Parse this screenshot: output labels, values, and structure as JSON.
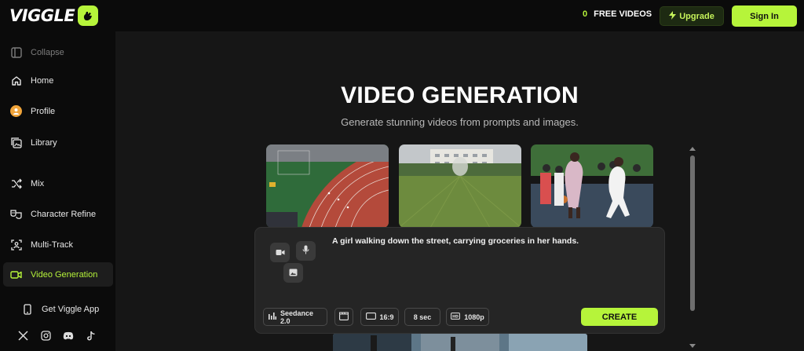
{
  "brand": {
    "name": "VIGGLE",
    "accent": "#b6f43a"
  },
  "header": {
    "credits_count": "0",
    "credits_label": "FREE VIDEOS",
    "upgrade_label": "Upgrade",
    "signin_label": "Sign In"
  },
  "sidebar": {
    "collapse_label": "Collapse",
    "items": [
      {
        "label": "Home",
        "icon": "home-icon"
      },
      {
        "label": "Profile",
        "icon": "profile-icon"
      },
      {
        "label": "Library",
        "icon": "library-icon"
      },
      {
        "label": "Mix",
        "icon": "shuffle-icon"
      },
      {
        "label": "Character Refine",
        "icon": "masks-icon"
      },
      {
        "label": "Multi-Track",
        "icon": "multi-track-icon"
      },
      {
        "label": "Video Generation",
        "icon": "video-camera-icon"
      }
    ],
    "get_app_label": "Get Viggle App",
    "socials": [
      "x-icon",
      "instagram-icon",
      "discord-icon",
      "tiktok-icon"
    ]
  },
  "main": {
    "title": "VIDEO GENERATION",
    "subtitle": "Generate stunning videos from prompts and images."
  },
  "prompt_panel": {
    "prompt_text": "A girl walking down the street, carrying groceries in her hands.",
    "model_label": "Seedance 2.0",
    "aspect_label": "16:9",
    "duration_label": "8 sec",
    "resolution_label": "1080p",
    "create_label": "CREATE"
  }
}
